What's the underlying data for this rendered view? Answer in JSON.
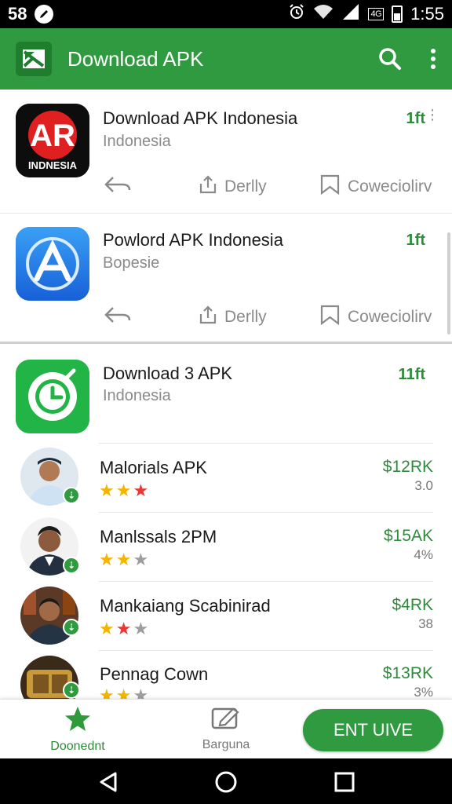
{
  "status_bar": {
    "left_text": "58",
    "time": "1:55",
    "signal_label": "4G"
  },
  "app_bar": {
    "title": "Download APK",
    "logo_icon": "image-download-icon",
    "search_icon": "search-icon",
    "more_icon": "more-vert-icon"
  },
  "featured": [
    {
      "title": "Download APK Indonesia",
      "subtitle": "Indonesia",
      "price": "1ft",
      "icon_text": "AR",
      "icon_subtext": "INDNESIA",
      "actions": {
        "back_label": "",
        "share_label": "Derlly",
        "bookmark_label": "Coweciolirv"
      }
    },
    {
      "title": "Powlord APK Indonesia",
      "subtitle": "Bopesie",
      "price": "1ft",
      "actions": {
        "back_label": "",
        "share_label": "Derlly",
        "bookmark_label": "Coweciolirv"
      }
    }
  ],
  "section": {
    "title": "Download 3 APK",
    "subtitle": "Indonesia",
    "price": "11ft"
  },
  "list": [
    {
      "title": "Malorials APK",
      "price": "$12RK",
      "rating": "3.0",
      "stars": [
        "on",
        "on",
        "red"
      ]
    },
    {
      "title": "Manlssals 2PM",
      "price": "$15AK",
      "rating": "4%",
      "stars": [
        "on",
        "on",
        "off"
      ]
    },
    {
      "title": "Mankaiang Scabinirad",
      "price": "$4RK",
      "rating": "38",
      "stars": [
        "on",
        "red",
        "off"
      ]
    },
    {
      "title": "Pennag Cown",
      "price": "$13RK",
      "rating": "3%",
      "stars": [
        "on",
        "on",
        "off"
      ]
    }
  ],
  "bottom_bar": {
    "tab1_label": "Doonednt",
    "tab2_label": "Barguna",
    "cta_label": "ENT UIVE"
  },
  "colors": {
    "primary": "#2f9a3f",
    "price_green": "#2e8b3a",
    "star": "#f4b400",
    "star_red": "#e53935"
  }
}
